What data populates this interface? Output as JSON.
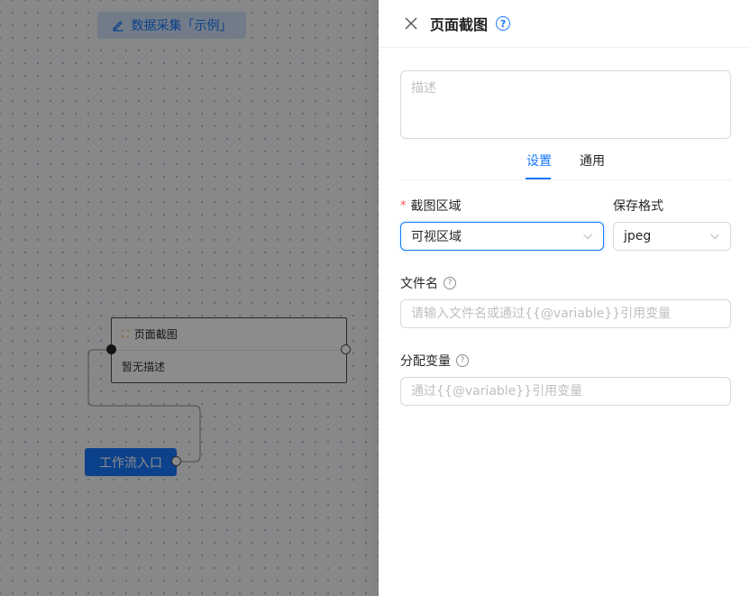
{
  "canvas": {
    "workflow_title": "数据采集「示例」",
    "node": {
      "title": "页面截图",
      "description": "暂无描述"
    },
    "start_node": "工作流入口"
  },
  "drawer": {
    "title": "页面截图",
    "description_placeholder": "描述",
    "tabs": [
      {
        "label": "设置",
        "active": true
      },
      {
        "label": "通用",
        "active": false
      }
    ],
    "fields": {
      "region": {
        "label": "截图区域",
        "required": true,
        "value": "可视区域"
      },
      "format": {
        "label": "保存格式",
        "value": "jpeg"
      },
      "filename": {
        "label": "文件名",
        "placeholder": "请输入文件名或通过{{@variable}}引用变量"
      },
      "variable": {
        "label": "分配变量",
        "placeholder": "通过{{@variable}}引用变量"
      }
    }
  },
  "colors": {
    "accent": "#1677ff",
    "required": "#ff4d4f",
    "mask": "rgba(0,0,0,0.45)"
  },
  "icons": [
    "edit-icon",
    "screenshot-icon",
    "close-icon",
    "help-icon",
    "question-icon",
    "chevron-down-icon"
  ]
}
